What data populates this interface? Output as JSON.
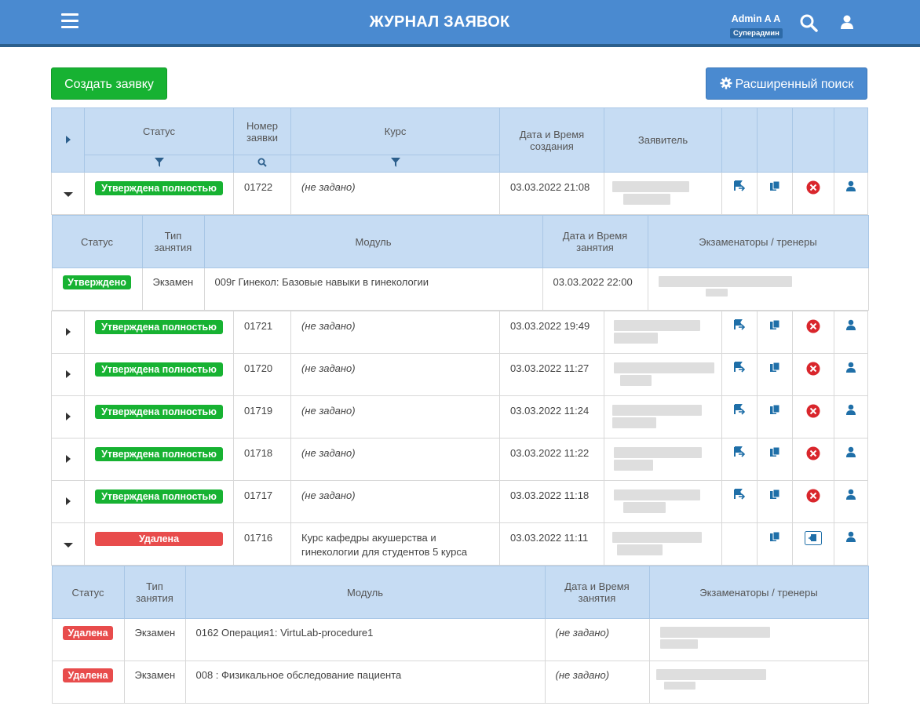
{
  "header": {
    "title": "ЖУРНАЛ ЗАЯВОК",
    "user_name": "Admin A A",
    "user_role": "Суперадмин"
  },
  "toolbar": {
    "create_label": "Создать заявку",
    "advanced_search_label": "Расширенный поиск"
  },
  "table": {
    "columns": {
      "status": "Статус",
      "number": "Номер заявки",
      "course": "Курс",
      "created": "Дата и Время создания",
      "applicant": "Заявитель"
    },
    "rows": [
      {
        "status": "Утверждена полностью",
        "status_type": "approved",
        "number": "01722",
        "course": "(не задано)",
        "created": "03.03.2022 21:08",
        "expanded": true
      },
      {
        "status": "Утверждена полностью",
        "status_type": "approved",
        "number": "01721",
        "course": "(не задано)",
        "created": "03.03.2022 19:49"
      },
      {
        "status": "Утверждена полностью",
        "status_type": "approved",
        "number": "01720",
        "course": "(не задано)",
        "created": "03.03.2022 11:27"
      },
      {
        "status": "Утверждена полностью",
        "status_type": "approved",
        "number": "01719",
        "course": "(не задано)",
        "created": "03.03.2022 11:24"
      },
      {
        "status": "Утверждена полностью",
        "status_type": "approved",
        "number": "01718",
        "course": "(не задано)",
        "created": "03.03.2022 11:22"
      },
      {
        "status": "Утверждена полностью",
        "status_type": "approved",
        "number": "01717",
        "course": "(не задано)",
        "created": "03.03.2022 11:18"
      },
      {
        "status": "Удалена",
        "status_type": "deleted",
        "number": "01716",
        "course": "Курс кафедры акушерства и гинекологии для студентов 5 курса",
        "created": "03.03.2022 11:11",
        "expanded": true
      }
    ]
  },
  "subtable": {
    "columns": {
      "status": "Статус",
      "type": "Тип занятия",
      "module": "Модуль",
      "datetime": "Дата и Время занятия",
      "examiners": "Экзаменаторы / тренеры"
    },
    "row_01722": [
      {
        "status": "Утверждено",
        "type": "Экзамен",
        "module": "009г Гинекол: Базовые навыки в гинекологии",
        "datetime": "03.03.2022 22:00"
      }
    ],
    "row_01716": [
      {
        "status": "Удалена",
        "type": "Экзамен",
        "module": "0162 Операция1: VirtuLab-procedure1",
        "datetime": "(не задано)"
      },
      {
        "status": "Удалена",
        "type": "Экзамен",
        "module": "008 : Физикальное обследование пациента",
        "datetime": "(не задано)"
      }
    ]
  },
  "colors": {
    "header_bg": "#4a8ad0",
    "approved": "#17b232",
    "deleted": "#e84c4c",
    "table_header": "#c6dcf3",
    "icon_blue": "#1f6fa8"
  },
  "icons": [
    "menu-icon",
    "search-icon",
    "user-icon",
    "gear-icon",
    "filter-icon",
    "magnifier-icon",
    "send-icon",
    "copy-icon",
    "cancel-icon",
    "restore-icon",
    "person-icon"
  ]
}
